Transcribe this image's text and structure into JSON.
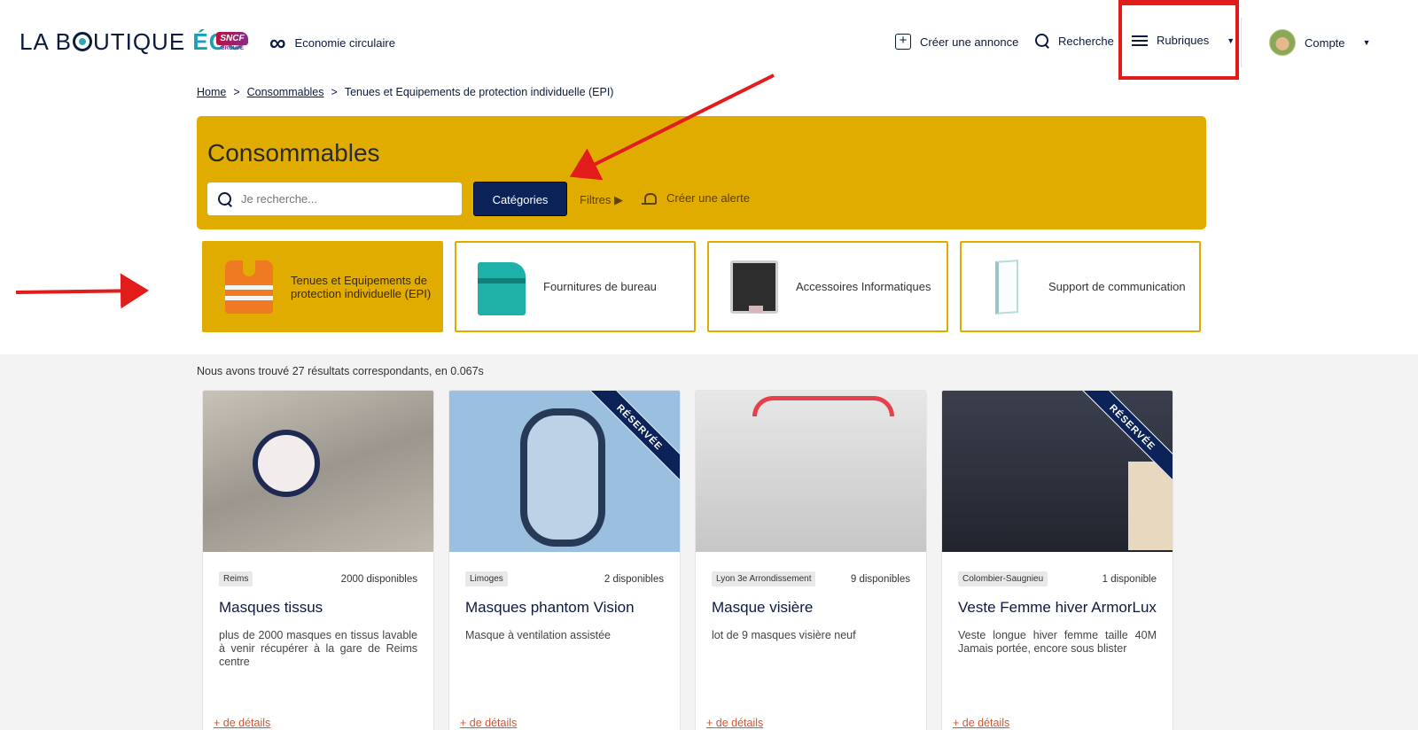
{
  "header": {
    "logo_prefix": "LA B",
    "logo_suffix": "UTIQUE ",
    "logo_eco": "ÉCO",
    "sncf": "SNCF",
    "sncf_sub": "GROUPE",
    "economie_circulaire": "Economie circulaire",
    "creer_annonce": "Créer une annonce",
    "recherche": "Recherche",
    "rubriques": "Rubriques",
    "compte": "Compte"
  },
  "breadcrumb": {
    "home": "Home",
    "sep": ">",
    "consommables": "Consommables",
    "current": "Tenues et Equipements de protection individuelle (EPI)"
  },
  "banner": {
    "title": "Consommables",
    "search_placeholder": "Je recherche...",
    "categories_button": "Catégories",
    "filtres": "Filtres ▶",
    "creer_alerte": "Créer une alerte"
  },
  "categories": [
    {
      "label": "Tenues et Equipements de protection individuelle (EPI)",
      "icon": "safety-vest-icon"
    },
    {
      "label": "Fournitures de bureau",
      "icon": "stapler-icon"
    },
    {
      "label": "Accessoires Informatiques",
      "icon": "computer-monitor-icon"
    },
    {
      "label": "Support de communication",
      "icon": "display-panel-icon"
    }
  ],
  "results": {
    "count_text": "Nous avons trouvé 27 résultats correspondants, en 0.067s"
  },
  "cards": [
    {
      "location": "Reims",
      "availability": "2000 disponibles",
      "title": "Masques tissus",
      "description": "plus de 2000 masques en tissus lavable à venir récupérer à la gare de Reims centre",
      "details": "+ de détails",
      "ribbon": ""
    },
    {
      "location": "Limoges",
      "availability": "2 disponibles",
      "title": "Masques phantom Vision",
      "description": "Masque à ventilation assistée",
      "details": "+ de détails",
      "ribbon": "RÉSERVÉE"
    },
    {
      "location": "Lyon 3e Arrondissement",
      "availability": "9 disponibles",
      "title": "Masque visière",
      "description": "lot de 9 masques visière neuf",
      "details": "+ de détails",
      "ribbon": ""
    },
    {
      "location": "Colombier-Saugnieu",
      "availability": "1 disponible",
      "title": "Veste Femme hiver ArmorLux",
      "description": "Veste longue hiver femme taille 40M Jamais portée, encore sous blister",
      "details": "+ de détails",
      "ribbon": "RÉSERVÉE"
    }
  ],
  "colors": {
    "accent_yellow": "#e1ac00",
    "navy": "#0b2358",
    "annotation_red": "#e21b1b",
    "link_orange": "#d4562e"
  }
}
